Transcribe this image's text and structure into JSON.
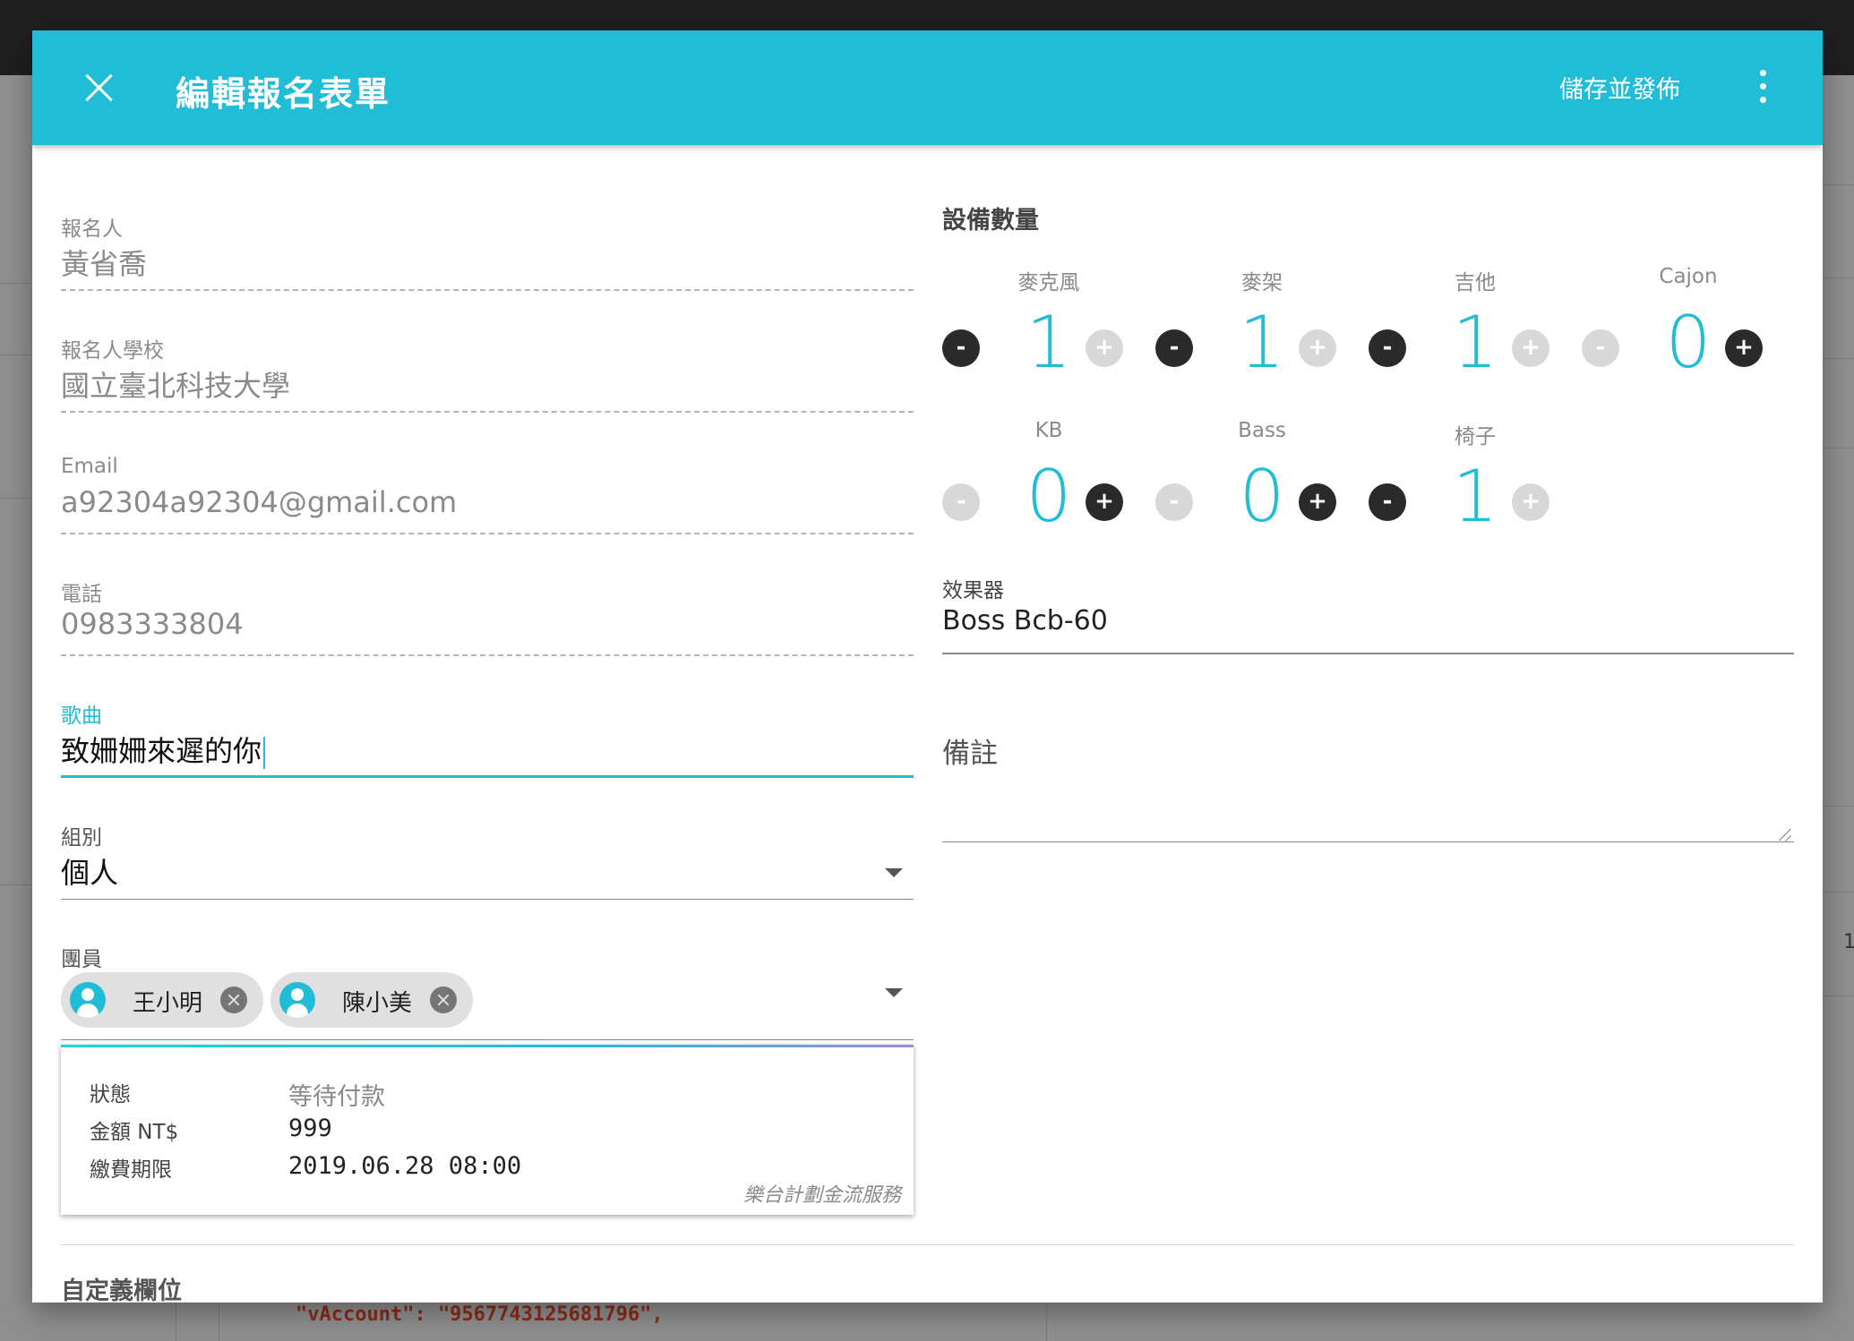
{
  "dialog": {
    "title": "編輯報名表單",
    "save_label": "儲存並發佈"
  },
  "form": {
    "applicant": {
      "label": "報名人",
      "value": "黃省喬"
    },
    "school": {
      "label": "報名人學校",
      "value": "國立臺北科技大學"
    },
    "email": {
      "label": "Email",
      "value": "a92304a92304@gmail.com"
    },
    "phone": {
      "label": "電話",
      "value": "0983333804"
    },
    "song": {
      "label": "歌曲",
      "value": "致姍姍來遲的你"
    },
    "group": {
      "label": "組別",
      "value": "個人"
    },
    "members": {
      "label": "團員",
      "chips": [
        "王小明",
        "陳小美"
      ]
    }
  },
  "payment": {
    "rows": [
      {
        "label": "狀態",
        "value": "等待付款"
      },
      {
        "label": "金額 NT$",
        "value": "999"
      },
      {
        "label": "繳費期限",
        "value": "2019.06.28 08:00"
      }
    ],
    "footer": "樂台計劃金流服務"
  },
  "custom_fields": {
    "title": "自定義欄位"
  },
  "equipment": {
    "title": "設備數量",
    "items": [
      {
        "name": "麥克風",
        "count": "1",
        "minus_enabled": true,
        "plus_enabled": false
      },
      {
        "name": "麥架",
        "count": "1",
        "minus_enabled": true,
        "plus_enabled": false
      },
      {
        "name": "吉他",
        "count": "1",
        "minus_enabled": true,
        "plus_enabled": false
      },
      {
        "name": "Cajon",
        "count": "0",
        "minus_enabled": false,
        "plus_enabled": true
      },
      {
        "name": "KB",
        "count": "0",
        "minus_enabled": false,
        "plus_enabled": true
      },
      {
        "name": "Bass",
        "count": "0",
        "minus_enabled": false,
        "plus_enabled": true
      },
      {
        "name": "椅子",
        "count": "1",
        "minus_enabled": true,
        "plus_enabled": false
      }
    ],
    "minus_symbol": "-",
    "plus_symbol": "+"
  },
  "effects": {
    "label": "效果器",
    "value": "Boss Bcb-60"
  },
  "notes": {
    "label": "備註",
    "value": ""
  },
  "background": {
    "code_line": "\"vAccount\": \"9567743125681796\","
  },
  "colors": {
    "accent": "#21bcd6",
    "toolbar": "#21bcd6"
  },
  "icons": [
    "close-icon",
    "more-vert-icon",
    "account-circle-icon",
    "cancel-icon",
    "arrow-drop-down-icon",
    "resize-grip-icon"
  ]
}
